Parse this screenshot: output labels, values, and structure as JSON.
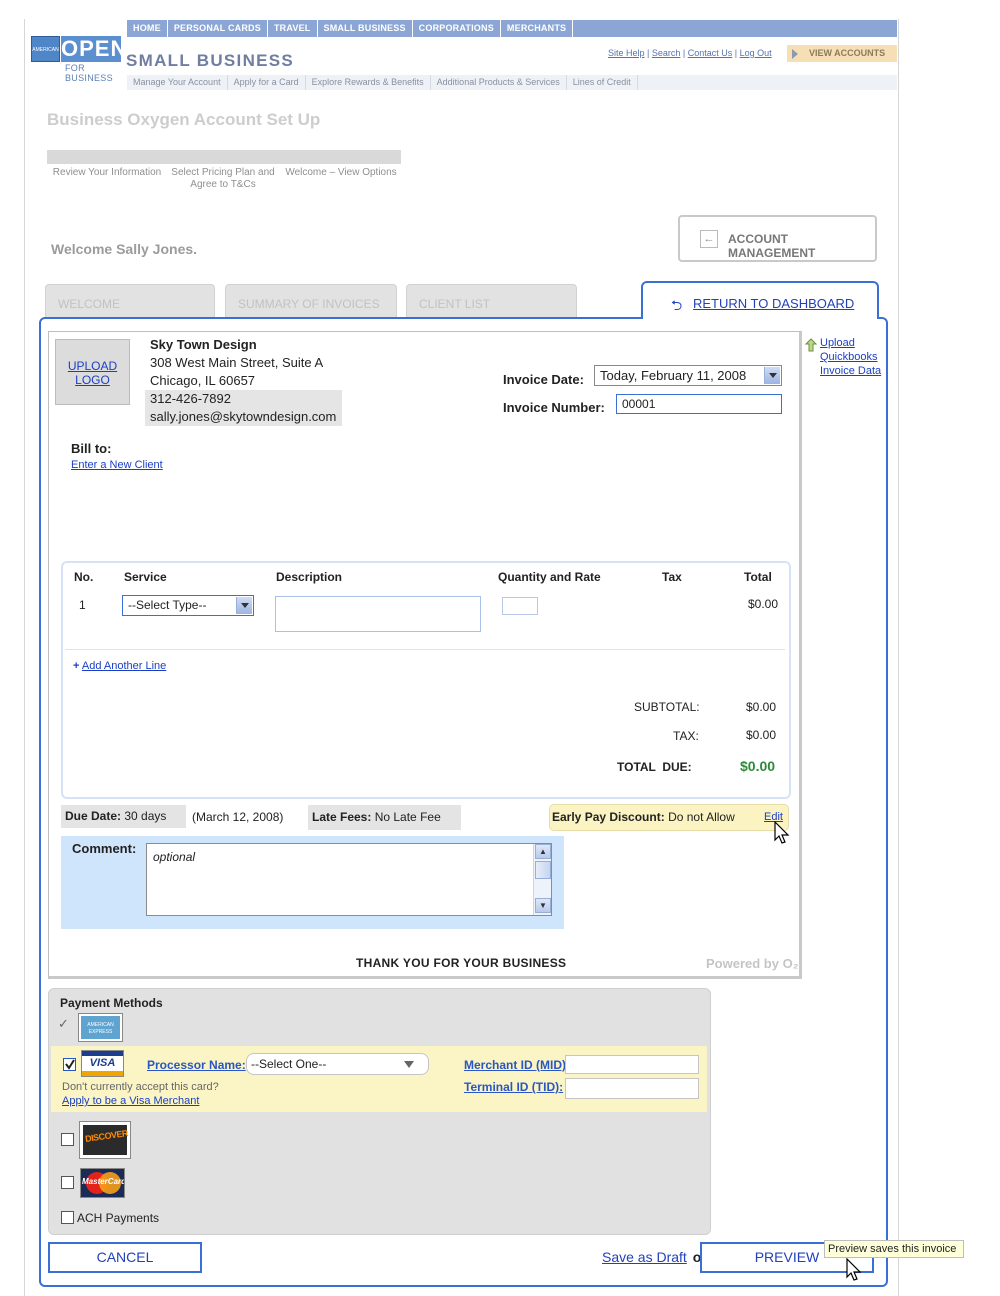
{
  "topnav": [
    "HOME",
    "PERSONAL CARDS",
    "TRAVEL",
    "SMALL BUSINESS",
    "CORPORATIONS",
    "MERCHANTS"
  ],
  "logo": {
    "badge": "AMERICAN EXPRESS",
    "open": "OPEN",
    "sub": "FOR BUSINESS"
  },
  "brand": "SMALL BUSINESS",
  "util_links": {
    "help": "Site Help",
    "search": "Search",
    "contact": "Contact Us",
    "logout": "Log Out"
  },
  "view_accounts": "VIEW ACCOUNTS",
  "subnav": [
    "Manage Your Account",
    "Apply for a Card",
    "Explore Rewards & Benefits",
    "Additional Products & Services",
    "Lines of Credit"
  ],
  "page_title": "Business Oxygen Account Set Up",
  "steps": [
    "Review Your Information",
    "Select Pricing Plan and Agree to T&Cs",
    "Welcome – View Options"
  ],
  "welcome": "Welcome Sally Jones.",
  "account_management": {
    "arrow": "←",
    "label": "ACCOUNT MANAGEMENT"
  },
  "tabs": {
    "welcome": "WELCOME",
    "summary": "SUMMARY OF INVOICES",
    "clients": "CLIENT LIST",
    "return_icon": "⮌",
    "return": "RETURN TO DASHBOARD"
  },
  "upload_quickbooks": "Upload Quickbooks Invoice Data",
  "company": {
    "upload_logo": "UPLOAD LOGO",
    "name": "Sky Town Design",
    "address1": "308 West Main Street, Suite A",
    "address2": "Chicago, IL 60657",
    "phone": "312-426-7892",
    "email": "sally.jones@skytowndesign.com"
  },
  "invoice_date": {
    "label": "Invoice Date:",
    "value": "Today, February 11, 2008"
  },
  "invoice_number": {
    "label": "Invoice Number:",
    "value": "00001"
  },
  "bill_to": {
    "label": "Bill to:",
    "link": "Enter a New Client"
  },
  "table": {
    "headers": {
      "no": "No.",
      "service": "Service",
      "description": "Description",
      "qty_rate": "Quantity and Rate",
      "tax": "Tax",
      "total": "Total"
    },
    "rows": [
      {
        "no": "1",
        "service": "--Select Type--",
        "total": "$0.00"
      }
    ],
    "add_line_plus": "+",
    "add_line": "Add Another Line"
  },
  "totals": {
    "subtotal_label": "SUBTOTAL:",
    "subtotal": "$0.00",
    "tax_label": "TAX:",
    "tax": "$0.00",
    "total_label": "TOTAL  DUE:",
    "total": "$0.00",
    "total_color": "#2e8b3a"
  },
  "due": {
    "label": "Due Date:",
    "value": "30 days",
    "date": "(March 12, 2008)"
  },
  "late_fees": {
    "label": "Late Fees:",
    "value": "No Late Fee"
  },
  "early_pay": {
    "label": "Early Pay Discount:",
    "value": "Do not Allow",
    "edit": "Edit"
  },
  "comment": {
    "label": "Comment:",
    "placeholder": "optional"
  },
  "thanks": "THANK YOU FOR YOUR BUSINESS",
  "powered": "Powered by O₂",
  "payment": {
    "title": "Payment Methods",
    "check": "✓",
    "amex_card": "AMERICAN EXPRESS",
    "visa_card": "VISA",
    "processor_label": "Processor Name:",
    "processor_value": "--Select One--",
    "mid_label": "Merchant ID (MID):",
    "tid_label": "Terminal ID (TID):",
    "not_accept": "Don't currently accept this card?",
    "apply_link": "Apply to be a Visa Merchant",
    "discover_card": "DISCOVER",
    "mastercard_card": "MasterCard",
    "ach": "ACH Payments"
  },
  "buttons": {
    "cancel": "CANCEL",
    "save_draft": "Save as Draft",
    "or": "or",
    "preview": "PREVIEW"
  },
  "tooltip": "Preview saves this invoice",
  "colors": {
    "accent": "#3a6fd4",
    "link": "#1a3fc4",
    "comment_bg": "#cfe5fb",
    "highlight": "#fbf5c5"
  }
}
